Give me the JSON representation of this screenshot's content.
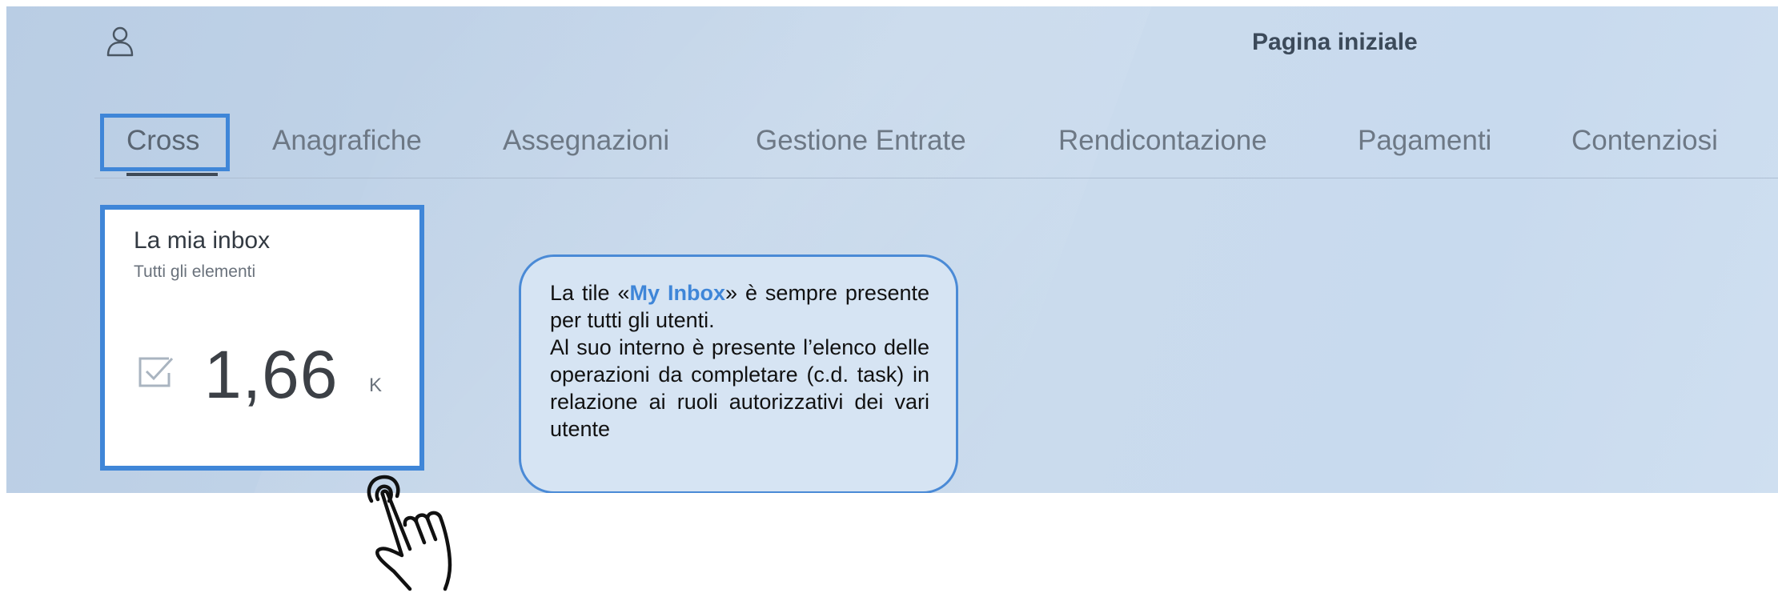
{
  "header": {
    "user_icon": "user-icon",
    "title": "Pagina iniziale"
  },
  "tabs": [
    {
      "label": "Cross",
      "active": true
    },
    {
      "label": "Anagrafiche"
    },
    {
      "label": "Assegnazioni"
    },
    {
      "label": "Gestione Entrate"
    },
    {
      "label": "Rendicontazione"
    },
    {
      "label": "Pagamenti"
    },
    {
      "label": "Contenziosi"
    }
  ],
  "tile": {
    "title": "La mia inbox",
    "subtitle": "Tutti gli elementi",
    "icon": "checkbox-icon",
    "value": "1,66",
    "unit": "K"
  },
  "callout": {
    "line1_pre": "La tile «",
    "line1_em": "My Inbox",
    "line1_post": "» è sempre presente per tutti gli utenti.",
    "line2": "Al suo interno è presente l’elenco delle operazioni da completare (c.d. task) in relazione ai ruoli autorizzativi dei vari utente"
  },
  "colors": {
    "highlight": "#3f86d8",
    "background": "#c3d5e9"
  },
  "pointer_icon": "hand-pointer-icon"
}
